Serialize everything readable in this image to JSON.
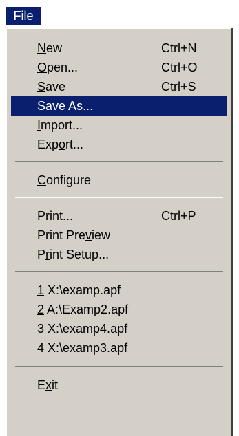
{
  "menubar": {
    "title_before": "",
    "title_mnemonic": "F",
    "title_after": "ile"
  },
  "items": [
    {
      "before": "",
      "mnemonic": "N",
      "after": "ew",
      "shortcut": "Ctrl+N"
    },
    {
      "before": "",
      "mnemonic": "O",
      "after": "pen...",
      "shortcut": "Ctrl+O"
    },
    {
      "before": "",
      "mnemonic": "S",
      "after": "ave",
      "shortcut": "Ctrl+S"
    },
    {
      "before": "Save ",
      "mnemonic": "A",
      "after": "s...",
      "shortcut": ""
    },
    {
      "before": "",
      "mnemonic": "I",
      "after": "mport...",
      "shortcut": ""
    },
    {
      "before": "Exp",
      "mnemonic": "o",
      "after": "rt...",
      "shortcut": ""
    },
    {
      "before": "",
      "mnemonic": "C",
      "after": "onfigure",
      "shortcut": ""
    },
    {
      "before": "",
      "mnemonic": "P",
      "after": "rint...",
      "shortcut": "Ctrl+P"
    },
    {
      "before": "Print Pre",
      "mnemonic": "v",
      "after": "iew",
      "shortcut": ""
    },
    {
      "before": "P",
      "mnemonic": "r",
      "after": "int Setup...",
      "shortcut": ""
    },
    {
      "before": "",
      "mnemonic": "1",
      "after": " X:\\examp.apf",
      "shortcut": ""
    },
    {
      "before": "",
      "mnemonic": "2",
      "after": " A:\\Examp2.apf",
      "shortcut": ""
    },
    {
      "before": "",
      "mnemonic": "3",
      "after": " X:\\examp4.apf",
      "shortcut": ""
    },
    {
      "before": "",
      "mnemonic": "4",
      "after": " X:\\examp3.apf",
      "shortcut": ""
    },
    {
      "before": "E",
      "mnemonic": "x",
      "after": "it",
      "shortcut": ""
    }
  ],
  "highlighted_item": "Save As...",
  "colors": {
    "menu_background": "#d4d0c8",
    "highlight": "#0a1f6e",
    "highlight_text": "#ffffff"
  }
}
